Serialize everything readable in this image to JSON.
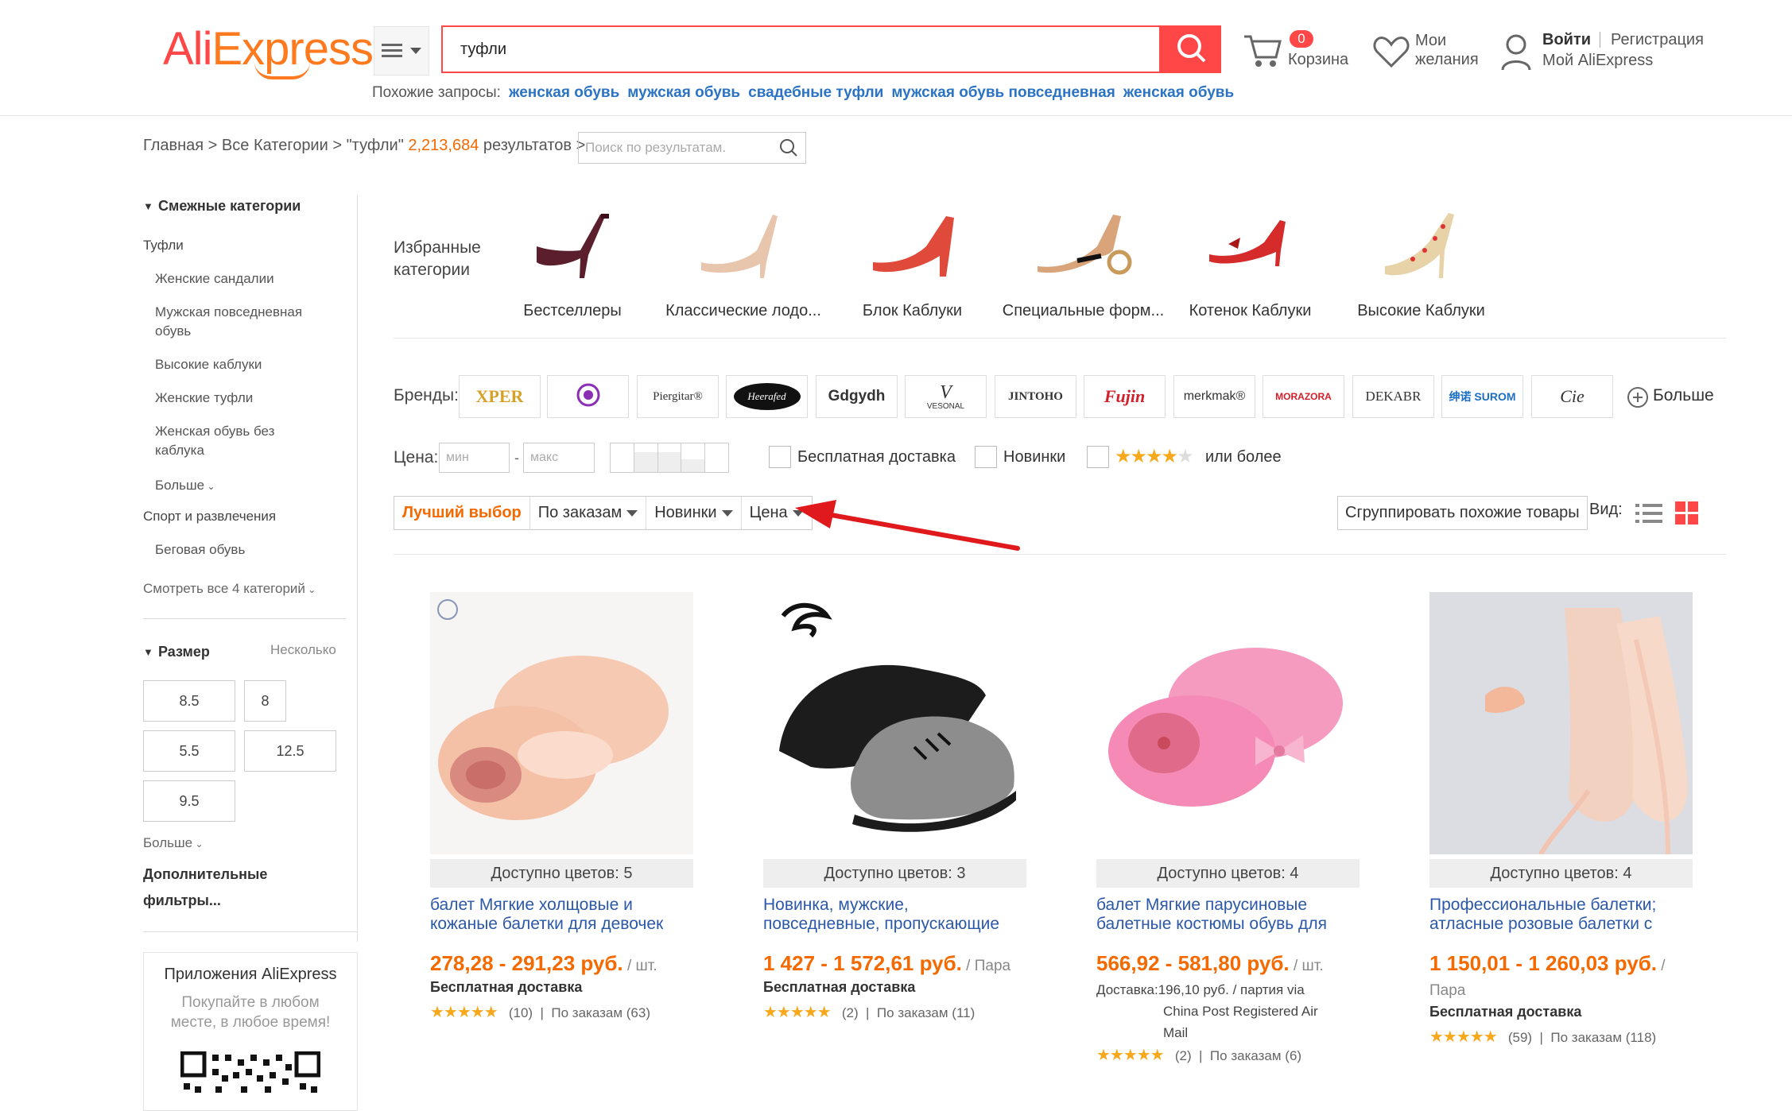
{
  "header": {
    "logo_ali": "Ali",
    "logo_express": "Express",
    "logo_tm": "™",
    "search_value": "туфли",
    "related_label": "Похожие запросы:",
    "related": [
      "женская обувь",
      "мужская обувь",
      "свадебные туфли",
      "мужская обувь повседневная",
      "женская обувь"
    ],
    "cart_count": "0",
    "cart_label": "Корзина",
    "wishlist_line1": "Мои",
    "wishlist_line2": "желания",
    "login": "Войти",
    "register": "Регистрация",
    "my_account": "Мой AliExpress"
  },
  "breadcrumb": {
    "home": "Главная",
    "all": "Все Категории",
    "query": "\"туфли\"",
    "count": "2,213,684",
    "results": "результатов",
    "search_placeholder": "Поиск по результатам."
  },
  "sidebar": {
    "related_title": "Смежные категории",
    "cat_shoes": "Туфли",
    "items": [
      "Женские сандалии",
      "Мужская повседневная",
      "обувь",
      "Высокие каблуки",
      "Женские туфли",
      "Женская обувь без",
      "каблука"
    ],
    "more1": "Больше",
    "sport": "Спорт и развлечения",
    "running": "Беговая обувь",
    "see_all": "Смотреть все 4 категорий",
    "size_title": "Размер",
    "size_multi": "Несколько",
    "sizes": [
      "8.5",
      "8",
      "5.5",
      "12.5",
      "9.5"
    ],
    "more2": "Больше",
    "extra1": "Дополнительные",
    "extra2": "фильтры...",
    "apps_title": "Приложения AliExpress",
    "apps_line1": "Покупайте в любом",
    "apps_line2": "месте, в любое время!"
  },
  "featured": {
    "label1": "Избранные",
    "label2": "категории",
    "cats": [
      "Бестселлеры",
      "Классические лодо...",
      "Блок Каблуки",
      "Специальные форм...",
      "Котенок Каблуки",
      "Высокие Каблуки"
    ]
  },
  "brands": {
    "label": "Бренды:",
    "names": [
      "XPER",
      "",
      "Piergitar®",
      "Heerafed",
      "Gdgydh",
      "VESONAL",
      "JINTOHO",
      "Fujin",
      "merkmak®",
      "MORAZORA",
      "DEKABR",
      "绅诺 SUROM",
      "Cie"
    ],
    "more": "Больше"
  },
  "filters": {
    "price_label": "Цена:",
    "min_placeholder": "мин",
    "max_placeholder": "макс",
    "free_shipping": "Бесплатная доставка",
    "new": "Новинки",
    "or_more": "или более"
  },
  "sort": {
    "best": "Лучший выбор",
    "orders": "По заказам",
    "new": "Новинки",
    "price": "Цена",
    "group": "Сгруппировать похожие товары",
    "view": "Вид:"
  },
  "products": [
    {
      "colors": "Доступно цветов: 5",
      "title1": "балет Мягкие холщовые и",
      "title2": "кожаные балетки для девочек",
      "price": "278,28 - 291,23 руб.",
      "unit": " / шт.",
      "shipping": "Бесплатная доставка",
      "reviews": "(10)",
      "orders": "По заказам (63)"
    },
    {
      "colors": "Доступно цветов: 3",
      "title1": "Новинка, мужские,",
      "title2": "повседневные, пропускающие",
      "price": "1 427 - 1 572,61 руб.",
      "unit": " / Пара",
      "shipping": "Бесплатная доставка",
      "reviews": "(2)",
      "orders": "По заказам (11)"
    },
    {
      "colors": "Доступно цветов: 4",
      "title1": "балет Мягкие парусиновые",
      "title2": "балетные костюмы обувь для",
      "price": "566,92 - 581,80 руб.",
      "unit": " / шт.",
      "shipping_line1": "Доставка:196,10 руб. / партия via",
      "shipping_line2": "China Post Registered Air",
      "shipping_line3": "Mail",
      "reviews": "(2)",
      "orders": "По заказам (6)"
    },
    {
      "colors": "Доступно цветов: 4",
      "title1": "Профессиональные балетки;",
      "title2": "атласные розовые балетки с",
      "price": "1 150,01 - 1 260,03 руб.",
      "unit": " / Пара",
      "shipping": "Бесплатная доставка",
      "reviews": "(59)",
      "orders": "По заказам (118)"
    }
  ],
  "colors": {
    "accent": "#ff4747",
    "orange": "#f46900",
    "link": "#2b73c5",
    "arrow": "#e0191d"
  },
  "icons": [
    "menu-icon",
    "search-icon",
    "cart-icon",
    "heart-icon",
    "user-icon",
    "list-view-icon",
    "grid-view-icon",
    "plus-icon"
  ]
}
